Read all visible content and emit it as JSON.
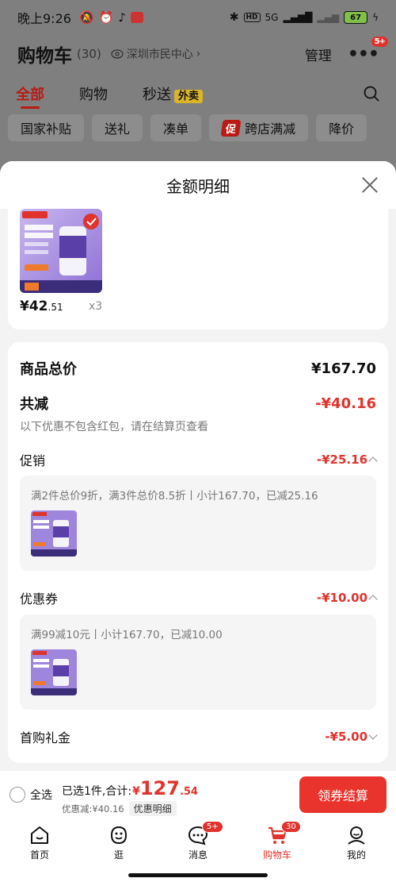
{
  "status_bar": {
    "time": "晚上9:26",
    "battery": "67",
    "network": "5G"
  },
  "header": {
    "title": "购物车",
    "count": "(30)",
    "location": "深圳市民中心",
    "manage": "管理",
    "more_badge": "5+"
  },
  "top_tabs": [
    {
      "label": "全部",
      "active": true
    },
    {
      "label": "购物",
      "active": false
    },
    {
      "label": "秒送",
      "active": false,
      "tag": "外卖"
    }
  ],
  "filter_chips": [
    {
      "label": "国家补贴"
    },
    {
      "label": "送礼"
    },
    {
      "label": "凑单"
    },
    {
      "label": "跨店满减",
      "promo": "促"
    },
    {
      "label": "降价"
    }
  ],
  "sheet": {
    "title": "金额明细",
    "product": {
      "price_int": "¥42",
      "price_dec": ".51",
      "qty": "x3"
    },
    "summary": {
      "total_label": "商品总价",
      "total_value": "¥167.70",
      "discount_label": "共减",
      "discount_value": "-¥40.16",
      "note": "以下优惠不包含红包，请在结算页查看"
    },
    "promotion": {
      "label": "促销",
      "value": "-¥25.16",
      "detail": "满2件总价9折，满3件总价8.5折丨小计167.70，已减25.16"
    },
    "coupon": {
      "label": "优惠券",
      "value": "-¥10.00",
      "detail": "满99减10元丨小计167.70，已减10.00"
    },
    "first_gift": {
      "label": "首购礼金",
      "value": "-¥5.00"
    }
  },
  "checkout": {
    "select_all": "全选",
    "selected_text": "已选1件,合计:",
    "amount_yen": "¥",
    "amount_int": "127",
    "amount_dec": ".54",
    "discount_text": "优惠减:¥40.16",
    "detail_button": "优惠明细",
    "pay_button": "领券结算"
  },
  "bottom_nav": [
    {
      "label": "首页",
      "icon": "home-icon"
    },
    {
      "label": "逛",
      "icon": "stroll-icon"
    },
    {
      "label": "消息",
      "icon": "message-icon",
      "badge": "5+"
    },
    {
      "label": "购物车",
      "icon": "cart-icon",
      "badge": "30",
      "active": true
    },
    {
      "label": "我的",
      "icon": "profile-icon"
    }
  ],
  "colors": {
    "accent": "#e0332d",
    "brand_dark": "#b81a14",
    "overlay": "#7f7f7f"
  }
}
